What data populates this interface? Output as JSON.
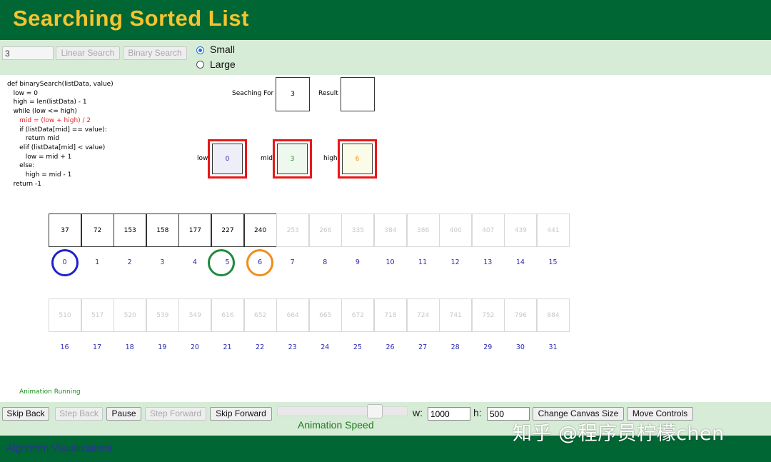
{
  "header": {
    "title": "Searching Sorted List"
  },
  "controls": {
    "search_value": "3",
    "linear_label": "Linear Search",
    "binary_label": "Binary Search",
    "size_options": [
      "Small",
      "Large"
    ],
    "size_selected": "Small"
  },
  "code": {
    "lines": [
      "def binarySearch(listData, value)",
      "   low = 0",
      "   high = len(listData) - 1",
      "   while (low <= high)",
      "      mid = (low + high) / 2",
      "      if (listData[mid] == value):",
      "         return mid",
      "      elif (listData[mid] < value)",
      "         low = mid + 1",
      "      else:",
      "         high = mid - 1",
      "   return -1"
    ],
    "highlighted_line": 4,
    "highlight_color": "#e8252a"
  },
  "search": {
    "searching_label": "Seaching For",
    "searching_value": "3",
    "result_label": "Result",
    "result_value": ""
  },
  "pointers": {
    "low_label": "low",
    "low_value": "0",
    "low_color": "#2a2ab0",
    "mid_label": "mid",
    "mid_value": "3",
    "mid_color": "#1e8f1e",
    "high_label": "high",
    "high_value": "6",
    "high_color": "#f28c18"
  },
  "array_row1": {
    "values": [
      "37",
      "72",
      "153",
      "158",
      "177",
      "227",
      "240",
      "253",
      "266",
      "335",
      "384",
      "386",
      "400",
      "407",
      "439",
      "441"
    ],
    "indices": [
      "0",
      "1",
      "2",
      "3",
      "4",
      "5",
      "6",
      "7",
      "8",
      "9",
      "10",
      "11",
      "12",
      "13",
      "14",
      "15"
    ]
  },
  "array_row2": {
    "values": [
      "510",
      "517",
      "520",
      "539",
      "549",
      "616",
      "652",
      "664",
      "665",
      "672",
      "718",
      "724",
      "741",
      "752",
      "796",
      "884"
    ],
    "indices": [
      "16",
      "17",
      "18",
      "19",
      "20",
      "21",
      "22",
      "23",
      "24",
      "25",
      "26",
      "27",
      "28",
      "29",
      "30",
      "31"
    ]
  },
  "active_range": {
    "low": 0,
    "high": 6,
    "mid_marker": 5
  },
  "status": {
    "text": "Animation Running"
  },
  "bottom": {
    "skip_back": "Skip Back",
    "step_back": "Step Back",
    "pause": "Pause",
    "step_forward": "Step Forward",
    "skip_forward": "Skip Forward",
    "speed_label": "Animation Speed",
    "w_label": "w:",
    "w_value": "1000",
    "h_label": "h:",
    "h_value": "500",
    "change_canvas": "Change Canvas Size",
    "move_controls": "Move Controls"
  },
  "footer": {
    "text": "Algorithm Visualizations"
  },
  "watermark": {
    "text": "知乎 @程序员柠檬chen"
  },
  "colors": {
    "header_bg": "#006633",
    "title": "#f4c430",
    "panel_bg": "#d7ecd7",
    "red_box": "#e81818",
    "index_blue": "#2a2ab0"
  }
}
